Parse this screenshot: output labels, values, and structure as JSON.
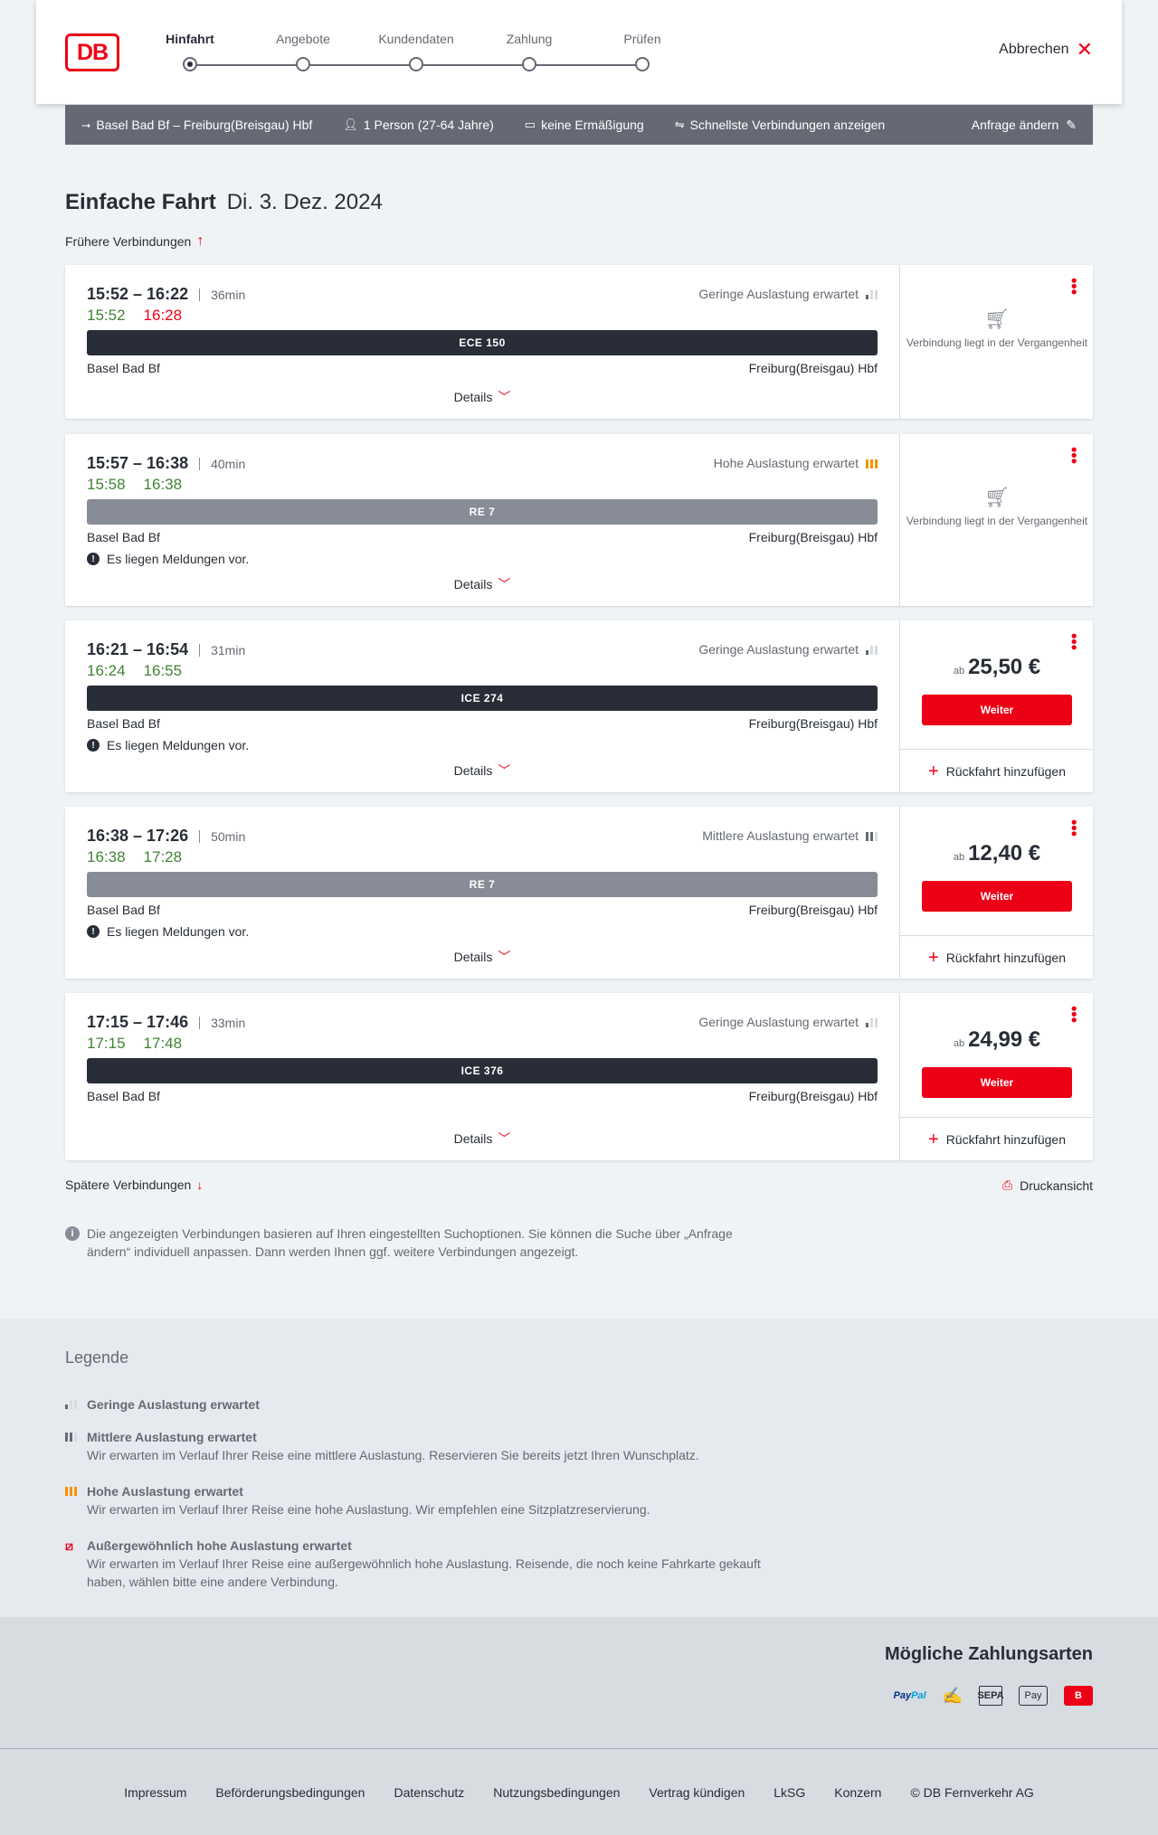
{
  "header": {
    "logo": "DB",
    "steps": [
      "Hinfahrt",
      "Angebote",
      "Kundendaten",
      "Zahlung",
      "Prüfen"
    ],
    "active_step": 0,
    "cancel": "Abbrechen"
  },
  "searchbar": {
    "route": "Basel Bad Bf – Freiburg(Breisgau) Hbf",
    "persons": "1 Person (27-64 Jahre)",
    "discount": "keine Ermäßigung",
    "fastest": "Schnellste Verbindungen anzeigen",
    "edit": "Anfrage ändern"
  },
  "title": {
    "main": "Einfache Fahrt",
    "date": "Di. 3. Dez. 2024"
  },
  "earlier": "Frühere Verbindungen",
  "later": "Spätere Verbindungen",
  "print": "Druckansicht",
  "details_label": "Details",
  "message_label": "Es liegen Meldungen vor.",
  "past_label": "Verbindung liegt in der Vergangenheit",
  "weiter_label": "Weiter",
  "return_label": "Rückfahrt hinzufügen",
  "price_prefix": "ab",
  "connections": [
    {
      "times": "15:52 – 16:22",
      "duration": "36min",
      "rt_dep": "15:52",
      "rt_arr": "16:28",
      "rt_arr_color": "red",
      "occupancy": "Geringe Auslastung erwartet",
      "occ_level": 1,
      "train": "ECE 150",
      "bar": "dark",
      "from": "Basel Bad Bf",
      "to": "Freiburg(Breisgau) Hbf",
      "message": false,
      "past": true,
      "price": ""
    },
    {
      "times": "15:57 – 16:38",
      "duration": "40min",
      "rt_dep": "15:58",
      "rt_arr": "16:38",
      "rt_arr_color": "green",
      "occupancy": "Hohe Auslastung erwartet",
      "occ_level": 3,
      "train": "RE 7",
      "bar": "gray",
      "from": "Basel Bad Bf",
      "to": "Freiburg(Breisgau) Hbf",
      "message": true,
      "past": true,
      "price": ""
    },
    {
      "times": "16:21 – 16:54",
      "duration": "31min",
      "rt_dep": "16:24",
      "rt_arr": "16:55",
      "rt_arr_color": "green",
      "occupancy": "Geringe Auslastung erwartet",
      "occ_level": 1,
      "train": "ICE 274",
      "bar": "dark",
      "from": "Basel Bad Bf",
      "to": "Freiburg(Breisgau) Hbf",
      "message": true,
      "past": false,
      "price": "25,50 €"
    },
    {
      "times": "16:38 – 17:26",
      "duration": "50min",
      "rt_dep": "16:38",
      "rt_arr": "17:28",
      "rt_arr_color": "green",
      "occupancy": "Mittlere Auslastung erwartet",
      "occ_level": 2,
      "train": "RE 7",
      "bar": "gray",
      "from": "Basel Bad Bf",
      "to": "Freiburg(Breisgau) Hbf",
      "message": true,
      "past": false,
      "price": "12,40 €"
    },
    {
      "times": "17:15 – 17:46",
      "duration": "33min",
      "rt_dep": "17:15",
      "rt_arr": "17:48",
      "rt_arr_color": "green",
      "occupancy": "Geringe Auslastung erwartet",
      "occ_level": 1,
      "train": "ICE 376",
      "bar": "dark",
      "from": "Basel Bad Bf",
      "to": "Freiburg(Breisgau) Hbf",
      "message": false,
      "past": false,
      "price": "24,99 €"
    }
  ],
  "info": "Die angezeigten Verbindungen basieren auf Ihren eingestellten Suchoptionen. Sie können die Suche über „Anfrage ändern“ individuell anpassen. Dann werden Ihnen ggf. weitere Verbindungen angezeigt.",
  "legend": {
    "title": "Legende",
    "items": [
      {
        "title": "Geringe Auslastung erwartet",
        "desc": ""
      },
      {
        "title": "Mittlere Auslastung erwartet",
        "desc": "Wir erwarten im Verlauf Ihrer Reise eine mittlere Auslastung. Reservieren Sie bereits jetzt Ihren Wunschplatz."
      },
      {
        "title": "Hohe Auslastung erwartet",
        "desc": "Wir erwarten im Verlauf Ihrer Reise eine hohe Auslastung. Wir empfehlen eine Sitzplatzreservierung."
      },
      {
        "title": "Außergewöhnlich hohe Auslastung erwartet",
        "desc": "Wir erwarten im Verlauf Ihrer Reise eine außergewöhnlich hohe Auslastung. Reisende, die noch keine Fahrkarte gekauft haben, wählen bitte eine andere Verbindung."
      }
    ]
  },
  "payment": {
    "title": "Mögliche Zahlungsarten",
    "paypal_a": "Pay",
    "paypal_b": "Pal",
    "sepa": "SEPA",
    "apple": "Pay"
  },
  "footer": [
    "Impressum",
    "Beförderungsbedingungen",
    "Datenschutz",
    "Nutzungsbedingungen",
    "Vertrag kündigen",
    "LkSG",
    "Konzern",
    "© DB Fernverkehr AG"
  ],
  "colors": {
    "red": "#ec0016",
    "green": "#408335",
    "dark": "#282d37",
    "gray": "#878c96",
    "orange": "#f39200"
  }
}
